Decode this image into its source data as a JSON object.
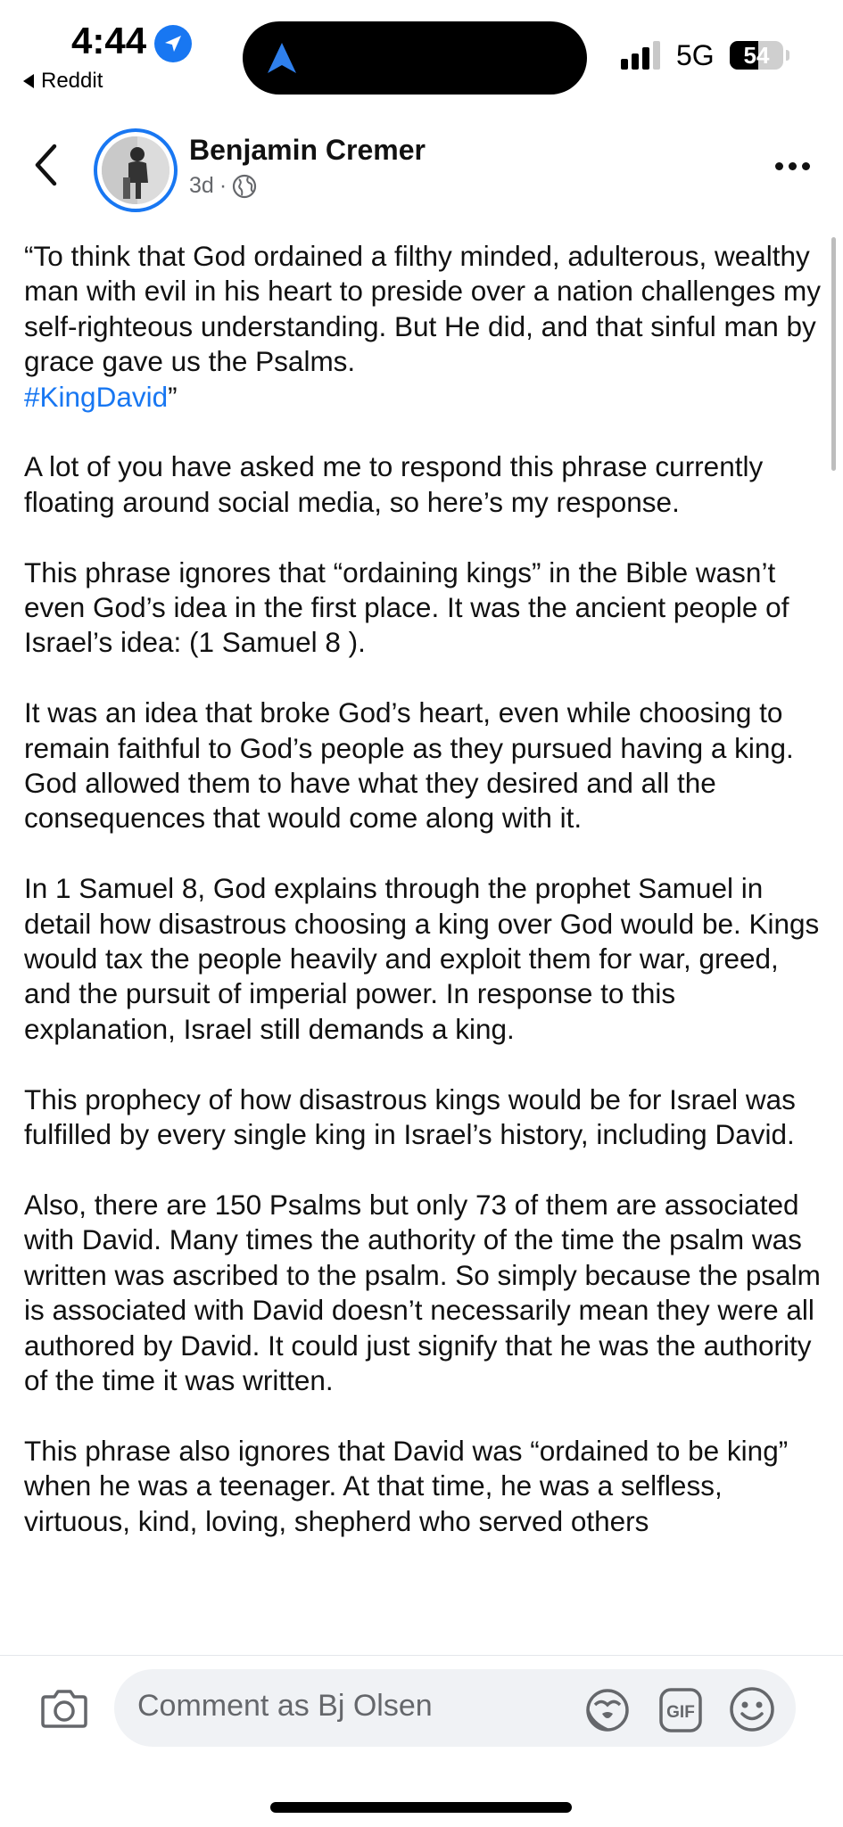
{
  "status_bar": {
    "time": "4:44",
    "back_app_label": "Reddit",
    "network": "5G",
    "battery": "54",
    "battery_level": 0.54
  },
  "post": {
    "author": "Benjamin Cremer",
    "age": "3d",
    "separator": "·",
    "privacy_icon": "globe-icon",
    "paragraphs": [
      "“To think that God ordained a filthy minded, adulterous, wealthy man with evil in his heart to preside over a nation challenges my self-righteous understanding. But He did, and that sinful man by grace gave us the Psalms.",
      "A lot of you have asked me to respond this phrase currently floating around social media, so here’s my response.",
      "This phrase ignores that “ordaining kings” in the Bible wasn’t even God’s idea in the first place. It was the ancient people of Israel’s idea: (1 Samuel 8 ).",
      "It was an idea that broke God’s heart, even while choosing to remain faithful to God’s people as they pursued having a king. God allowed them to have what they desired and all the consequences that would come along with it.",
      "In 1 Samuel 8, God explains through the prophet Samuel in detail how disastrous choosing a king over God would be. Kings would tax the people heavily and exploit them for war, greed, and the pursuit of imperial power. In response to this explanation, Israel still demands a king.",
      "This prophecy of how disastrous kings would be for Israel was fulfilled by every single king in Israel’s history, including David.",
      "Also, there are 150 Psalms but only 73 of them are associated with David. Many times the authority of the time the psalm was written was ascribed to the psalm. So simply because the psalm is associated with David doesn’t necessarily mean they were all authored by David. It could just signify that he was the authority of the time it was written.",
      "This phrase also ignores that David was “ordained to be king” when he was a teenager. At that time, he was a selfless, virtuous, kind, loving, shepherd who served others"
    ],
    "hashtag": "#KingDavid",
    "closing_quote": "”"
  },
  "comment_bar": {
    "placeholder": "Comment as Bj Olsen",
    "gif_label": "GIF"
  },
  "colors": {
    "accent": "#1877f2",
    "secondary_text": "#65676b",
    "input_bg": "#f0f2f5"
  }
}
